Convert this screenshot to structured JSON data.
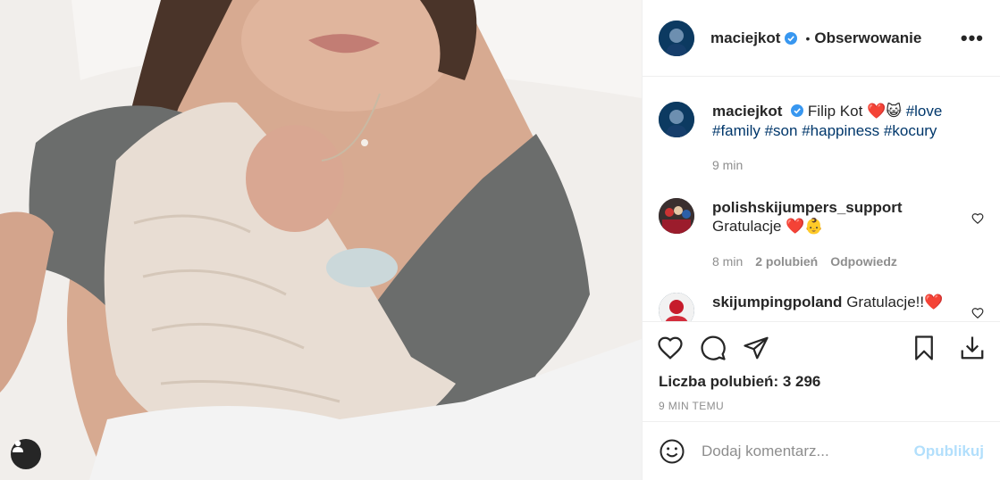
{
  "post": {
    "username": "maciejkot",
    "follow_label": "Obserwowanie",
    "dot": "•",
    "more_label": "•••"
  },
  "caption": {
    "username": "maciejkot",
    "text": "Filip Kot",
    "emojis": "❤️😺",
    "tags": [
      "#love",
      "#family",
      "#son",
      "#happiness",
      "#kocury"
    ],
    "time": "9 min"
  },
  "comments": [
    {
      "username": "polishskijumpers_support",
      "text": "Gratulacje",
      "emojis": "❤️👶",
      "time": "8 min",
      "likes": "2 polubień",
      "reply": "Odpowiedz"
    },
    {
      "username": "skijumpingpoland",
      "text": "Gratulacje!!",
      "emojis": "❤️"
    }
  ],
  "likes_text": "Liczba polubień: 3 296",
  "time_ago": "9 MIN TEMU",
  "add_comment": {
    "placeholder": "Dodaj komentarz...",
    "post_label": "Opublikuj"
  },
  "colors": {
    "link": "#00376b",
    "verified": "#3897f0",
    "muted": "#8e8e8e",
    "publish": "#b2dffc"
  }
}
